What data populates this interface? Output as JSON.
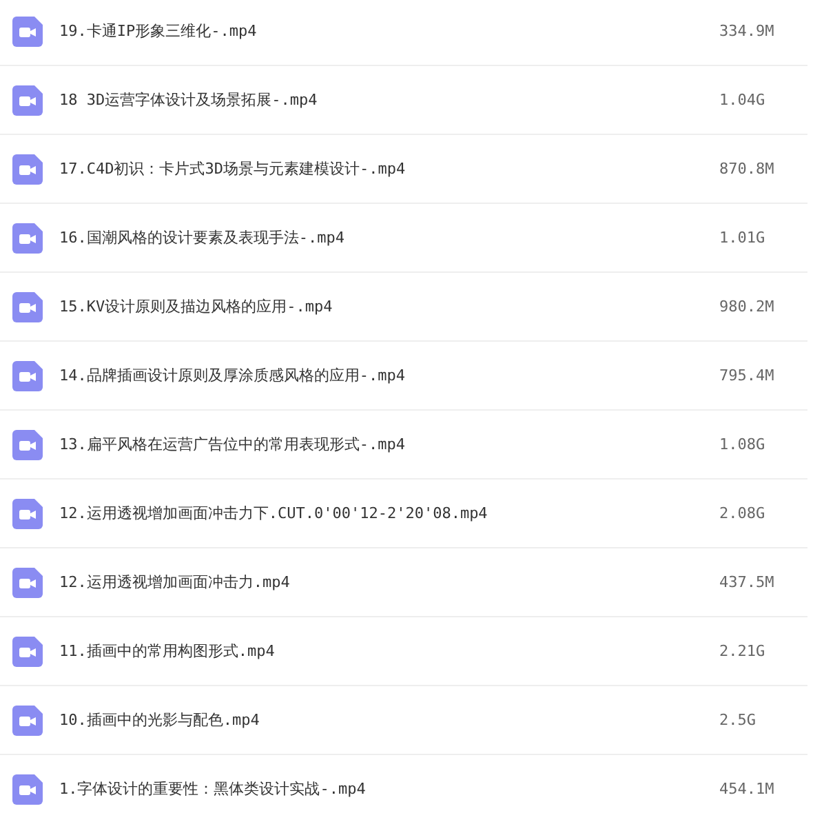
{
  "files": [
    {
      "name": "19.卡通IP形象三维化-.mp4",
      "size": "334.9M"
    },
    {
      "name": "18 3D运营字体设计及场景拓展-.mp4",
      "size": "1.04G"
    },
    {
      "name": "17.C4D初识：卡片式3D场景与元素建模设计-.mp4",
      "size": "870.8M"
    },
    {
      "name": "16.国潮风格的设计要素及表现手法-.mp4",
      "size": "1.01G"
    },
    {
      "name": "15.KV设计原则及描边风格的应用-.mp4",
      "size": "980.2M"
    },
    {
      "name": "14.品牌插画设计原则及厚涂质感风格的应用-.mp4",
      "size": "795.4M"
    },
    {
      "name": "13.扁平风格在运营广告位中的常用表现形式-.mp4",
      "size": "1.08G"
    },
    {
      "name": "12.运用透视增加画面冲击力下.CUT.0'00'12-2'20'08.mp4",
      "size": "2.08G"
    },
    {
      "name": "12.运用透视增加画面冲击力.mp4",
      "size": "437.5M"
    },
    {
      "name": "11.插画中的常用构图形式.mp4",
      "size": "2.21G"
    },
    {
      "name": "10.插画中的光影与配色.mp4",
      "size": "2.5G"
    },
    {
      "name": "1.字体设计的重要性：黑体类设计实战-.mp4",
      "size": "454.1M"
    }
  ]
}
